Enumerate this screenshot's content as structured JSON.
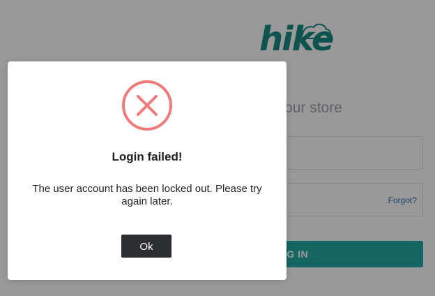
{
  "brand": {
    "logo_text": "hike",
    "logo_color": "#1a8a87"
  },
  "login_page": {
    "subtitle": "o your store",
    "forgot_label": "Forgot?",
    "login_button_label": "OG IN",
    "accent_color": "#23a9a3"
  },
  "dialog": {
    "icon": "error-x-circle-icon",
    "icon_color": "#f07b7b",
    "title": "Login failed!",
    "message": "The user account has been locked out. Please try again later.",
    "ok_label": "Ok"
  }
}
